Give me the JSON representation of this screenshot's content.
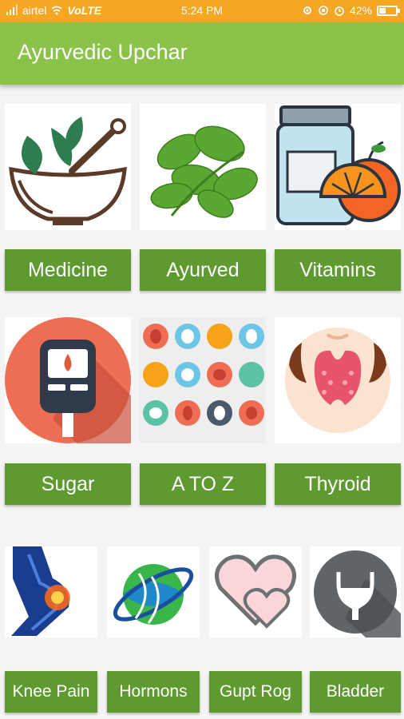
{
  "status_bar": {
    "carrier": "airtel",
    "network": "VoLTE",
    "time": "5:24 PM",
    "battery": "42%",
    "battery_level": 0.42,
    "background_color": "#f5a623"
  },
  "app_bar": {
    "title": "Ayurvedic Upchar",
    "background_color": "#8bc34a"
  },
  "button_color": "#5f9a31",
  "grid": {
    "row1": [
      {
        "label": "Medicine",
        "icon": "mortar-pestle-herbs-icon"
      },
      {
        "label": "Ayurved",
        "icon": "mint-leaves-icon"
      },
      {
        "label": "Vitamins",
        "icon": "vitamin-jar-orange-icon"
      }
    ],
    "row2": [
      {
        "label": "Sugar",
        "icon": "glucometer-icon"
      },
      {
        "label": "A TO Z",
        "icon": "organs-grid-icon"
      },
      {
        "label": "Thyroid",
        "icon": "thyroid-icon"
      }
    ],
    "row3": [
      {
        "label": "Knee Pain",
        "icon": "knee-pain-icon"
      },
      {
        "label": "Hormons",
        "icon": "dna-globe-icon"
      },
      {
        "label": "Gupt Rog",
        "icon": "hearts-icon"
      },
      {
        "label": "Bladder",
        "icon": "bladder-icon"
      }
    ]
  }
}
